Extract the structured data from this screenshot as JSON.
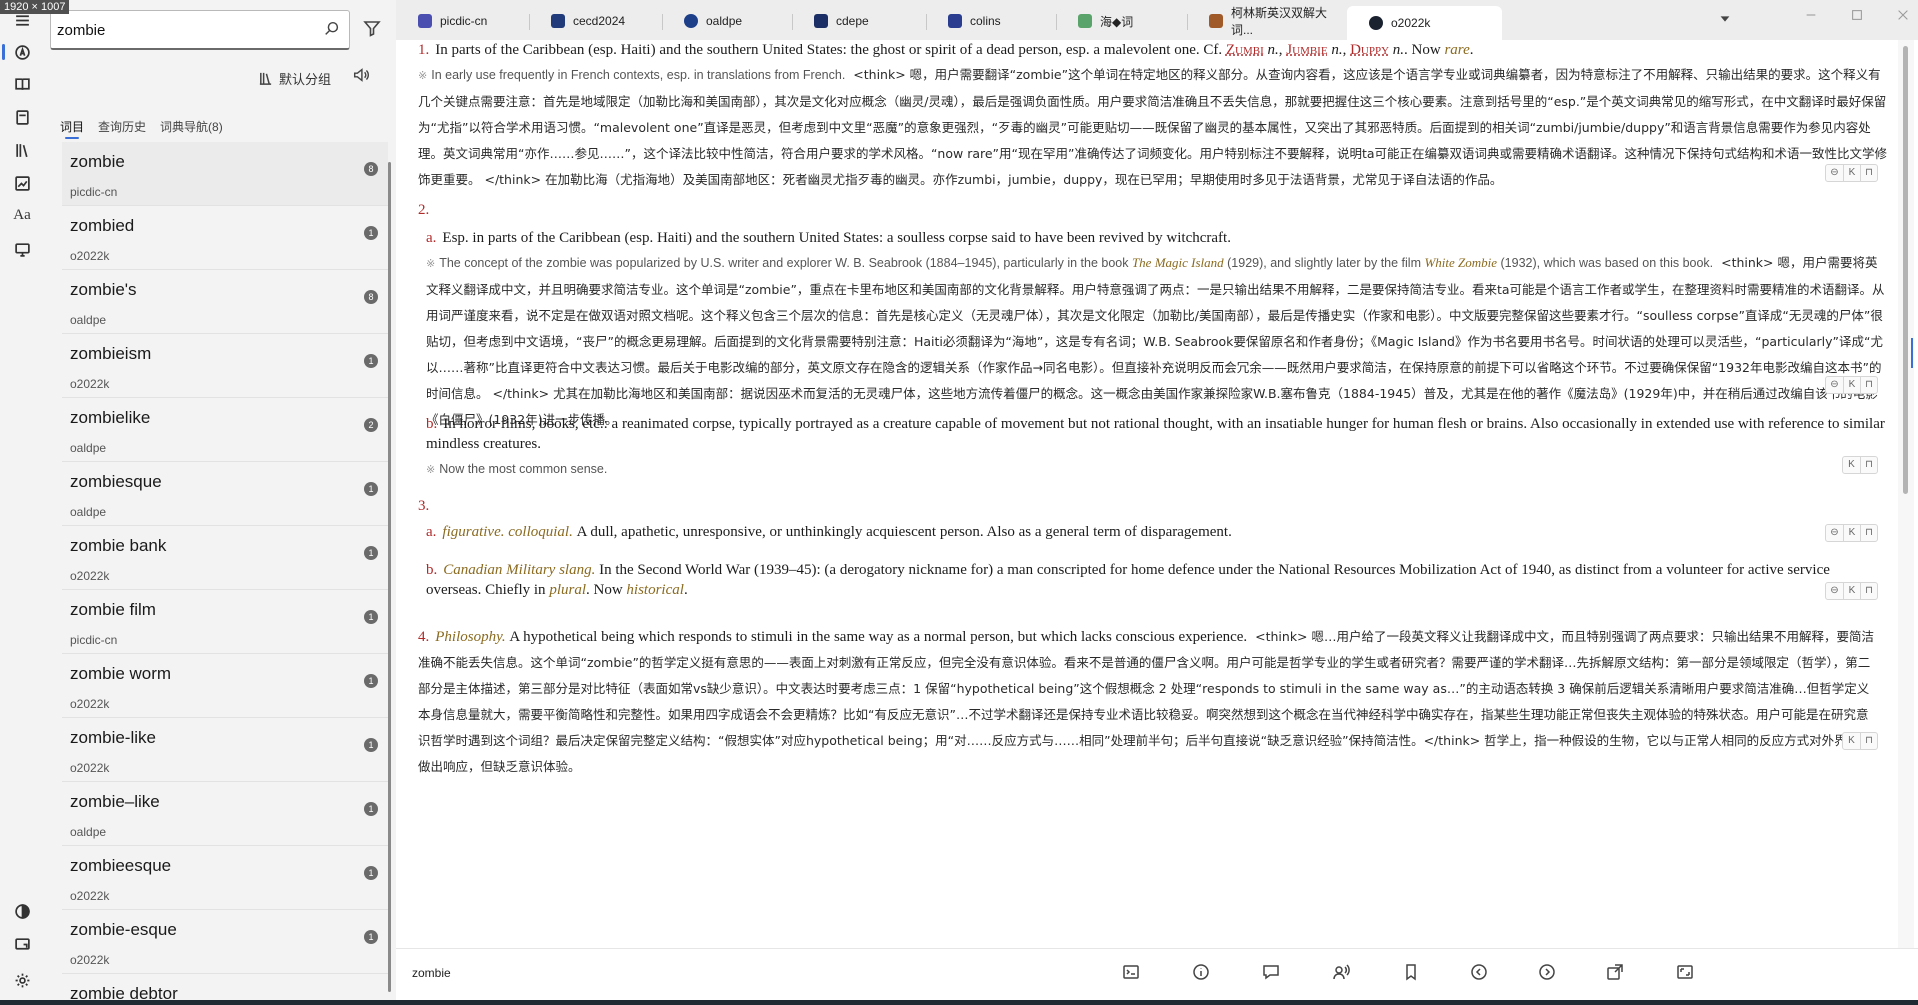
{
  "window": {
    "size_label": "1920 × 1007"
  },
  "sidebar_rail": {
    "items": [
      {
        "name": "menu-icon"
      },
      {
        "name": "lookup-icon"
      },
      {
        "name": "dictionary-icon"
      },
      {
        "name": "wordbook-icon"
      },
      {
        "name": "library-icon"
      },
      {
        "name": "statistics-icon"
      },
      {
        "name": "font-icon",
        "text": "Aa"
      },
      {
        "name": "monitor-icon"
      }
    ],
    "bottom_items": [
      {
        "name": "theme-icon"
      },
      {
        "name": "window-icon"
      },
      {
        "name": "settings-icon"
      }
    ]
  },
  "search": {
    "value": "zombie",
    "group_label": "默认分组"
  },
  "panel_tabs": [
    {
      "label": "词目",
      "active": true
    },
    {
      "label": "查询历史",
      "active": false
    },
    {
      "label": "词典导航(8)",
      "active": false
    }
  ],
  "results": [
    {
      "word": "zombie",
      "source": "picdic-cn",
      "count": "8"
    },
    {
      "word": "zombied",
      "source": "o2022k",
      "count": "1"
    },
    {
      "word": "zombie's",
      "source": "oaldpe",
      "count": "8"
    },
    {
      "word": "zombieism",
      "source": "o2022k",
      "count": "1"
    },
    {
      "word": "zombielike",
      "source": "oaldpe",
      "count": "2"
    },
    {
      "word": "zombiesque",
      "source": "oaldpe",
      "count": "1"
    },
    {
      "word": "zombie bank",
      "source": "o2022k",
      "count": "1"
    },
    {
      "word": "zombie film",
      "source": "picdic-cn",
      "count": "1"
    },
    {
      "word": "zombie worm",
      "source": "o2022k",
      "count": "1"
    },
    {
      "word": "zombie-like",
      "source": "o2022k",
      "count": "1"
    },
    {
      "word": "zombie–like",
      "source": "oaldpe",
      "count": "1"
    },
    {
      "word": "zombieesque",
      "source": "o2022k",
      "count": "1"
    },
    {
      "word": "zombie-esque",
      "source": "o2022k",
      "count": "1"
    },
    {
      "word": "zombie debtor",
      "source": "",
      "count": ""
    }
  ],
  "tabs": [
    {
      "label": "picdic-cn",
      "color": "#4a4fb0"
    },
    {
      "label": "cecd2024",
      "color": "#213a7a"
    },
    {
      "label": "oaldpe",
      "color": "#1d3f8a"
    },
    {
      "label": "cdepe",
      "color": "#1b2f66"
    },
    {
      "label": "colins",
      "color": "#2a3d8f"
    },
    {
      "label": "海◆词",
      "color": "#5aa36a"
    },
    {
      "label": "柯林斯英汉双解大词...",
      "color": "#a05a2a"
    },
    {
      "label": "o2022k",
      "color": "#1a2230",
      "active": true
    }
  ],
  "entry": {
    "s1": {
      "num": "1.",
      "text": "In parts of the Caribbean (esp. Haiti) and the southern United States: the ghost or spirit of a dead person, esp. a malevolent one. Cf. ",
      "xref1": "Zumbi",
      "xref2": "Jumbie",
      "xref3": "Duppy",
      "n": "n.",
      "now": "Now",
      "rare": "rare",
      "note_en": "In early use frequently in French contexts, esp. in translations from French.",
      "note_cn": "<think> 嗯，用户需要翻译“zombie”这个单词在特定地区的释义部分。从查询内容看，这应该是个语言学专业或词典编纂者，因为特意标注了不用解释、只输出结果的要求。这个释义有几个关键点需要注意：首先是地域限定（加勒比海和美国南部），其次是文化对应概念（幽灵/灵魂），最后是强调负面性质。用户要求简洁准确且不丢失信息，那就要把握住这三个核心要素。注意到括号里的“esp.”是个英文词典常见的缩写形式，在中文翻译时最好保留为“尤指”以符合学术用语习惯。“malevolent one”直译是恶灵，但考虑到中文里“恶魔”的意象更强烈，“歹毒的幽灵”可能更贴切——既保留了幽灵的基本属性，又突出了其邪恶特质。后面提到的相关词“zumbi/jumbie/duppy”和语言背景信息需要作为参见内容处理。英文词典常用“亦作……参见……”，这个译法比较中性简洁，符合用户要求的学术风格。“now rare”用“现在罕用”准确传达了词频变化。用户特别标注不要解释，说明ta可能正在编纂双语词典或需要精确术语翻译。这种情况下保持句式结构和术语一致性比文学修饰更重要。 </think> 在加勒比海（尤指海地）及美国南部地区：死者幽灵尤指歹毒的幽灵。亦作zumbi，jumbie，duppy，现在已罕用；早期使用时多见于法语背景，尤常见于译自法语的作品。"
    },
    "s2": {
      "num": "2.",
      "a_letter": "a.",
      "a_text": "Esp. in parts of the Caribbean (esp. Haiti) and the southern United States: a soulless corpse said to have been revived by witchcraft.",
      "a_note_pre": "The concept of the zombie was popularized by U.S. writer and explorer W. B. Seabrook (1884–1945), particularly in the book ",
      "a_book1": "The Magic Island",
      "a_note_mid": " (1929), and slightly later by the film ",
      "a_film": "White Zombie",
      "a_note_post": " (1932), which was based on this book.",
      "a_cn": "<think> 嗯，用户需要将英文释义翻译成中文，并且明确要求简洁专业。这个单词是“zombie”，重点在卡里布地区和美国南部的文化背景解释。用户特意强调了两点：一是只输出结果不用解释，二是要保持简洁专业。看来ta可能是个语言工作者或学生，在整理资料时需要精准的术语翻译。从用词严谨度来看，说不定是在做双语对照文档呢。这个释义包含三个层次的信息：首先是核心定义（无灵魂尸体），其次是文化限定（加勒比/美国南部），最后是传播史实（作家和电影）。中文版要完整保留这些要素才行。“soulless corpse”直译成“无灵魂的尸体”很贴切，但考虑到中文语境，“丧尸”的概念更易理解。后面提到的文化背景需要特别注意：Haiti必须翻译为“海地”，这是专有名词；W.B. Seabrook要保留原名和作者身份；《Magic Island》作为书名要用书名号。时间状语的处理可以灵活些，“particularly”译成“尤以……著称”比直译更符合中文表达习惯。最后关于电影改编的部分，英文原文存在隐含的逻辑关系（作家作品→同名电影）。但直接补充说明反而会冗余——既然用户要求简洁，在保持原意的前提下可以省略这个环节。不过要确保保留“1932年电影改编自这本书”的时间信息。 </think> 尤其在加勒比海地区和美国南部：据说因巫术而复活的无灵魂尸体，这些地方流传着僵尸的概念。这一概念由美国作家兼探险家W.B.塞布鲁克（1884-1945）普及，尤其是在他的著作《魔法岛》(1929年)中，并在稍后通过改编自该书的电影《白僵尸》(1932年)进一步传播。",
      "b_letter": "b.",
      "b_text": "In horror films, books, etc.: a reanimated corpse, typically portrayed as a creature capable of movement but not rational thought, with an insatiable hunger for human flesh or brains. Also occasionally in extended use with reference to similar mindless creatures.",
      "b_note": "Now the most common sense."
    },
    "s3": {
      "num": "3.",
      "a_letter": "a.",
      "a_lab1": "figurative",
      "a_lab2": "colloquial",
      "a_text": "A dull, apathetic, unresponsive, or unthinkingly acquiescent person. Also as a general term of disparagement.",
      "b_letter": "b.",
      "b_lab": "Canadian Military slang",
      "b_text": "In the Second World War (1939–45): (a derogatory nickname for) a man conscripted for home defence under the National Resources Mobilization Act of 1940, as distinct from a volunteer for active service overseas. Chiefly in ",
      "b_plural": "plural",
      "b_now": ". Now ",
      "b_hist": "historical",
      "b_end": "."
    },
    "s4": {
      "num": "4.",
      "lab": "Philosophy",
      "text": "A hypothetical being which responds to stimuli in the same way as a normal person, but which lacks conscious experience.",
      "cn": "<think> 嗯…用户给了一段英文释义让我翻译成中文，而且特别强调了两点要求：只输出结果不用解释，要简洁准确不能丢失信息。这个单词“zombie”的哲学定义挺有意思的——表面上对刺激有正常反应，但完全没有意识体验。看来不是普通的僵尸含义啊。用户可能是哲学专业的学生或者研究者？需要严谨的学术翻译…先拆解原文结构：第一部分是领域限定（哲学），第二部分是主体描述，第三部分是对比特征（表面如常vs缺少意识）。中文表达时要考虑三点：1 保留“hypothetical being”这个假想概念 2 处理“responds to stimuli in the same way as…”的主动语态转换 3 确保前后逻辑关系清晰用户要求简洁准确…但哲学定义本身信息量就大，需要平衡简略性和完整性。如果用四字成语会不会更精炼？比如“有反应无意识”…不过学术翻译还是保持专业术语比较稳妥。啊突然想到这个概念在当代神经科学中确实存在，指某些生理功能正常但丧失主观体验的特殊状态。用户可能是在研究意识哲学时遇到这个词组？最后决定保留完整定义结构：“假想实体”对应hypothetical being；用“对……反应方式与……相同”处理前半句；后半句直接说“缺乏意识经验”保持简洁性。</think> 哲学上，指一种假设的生物，它以与正常人相同的反应方式对外界刺激做出响应，但缺乏意识体验。"
    }
  },
  "toolbar": {
    "word": "zombie"
  }
}
